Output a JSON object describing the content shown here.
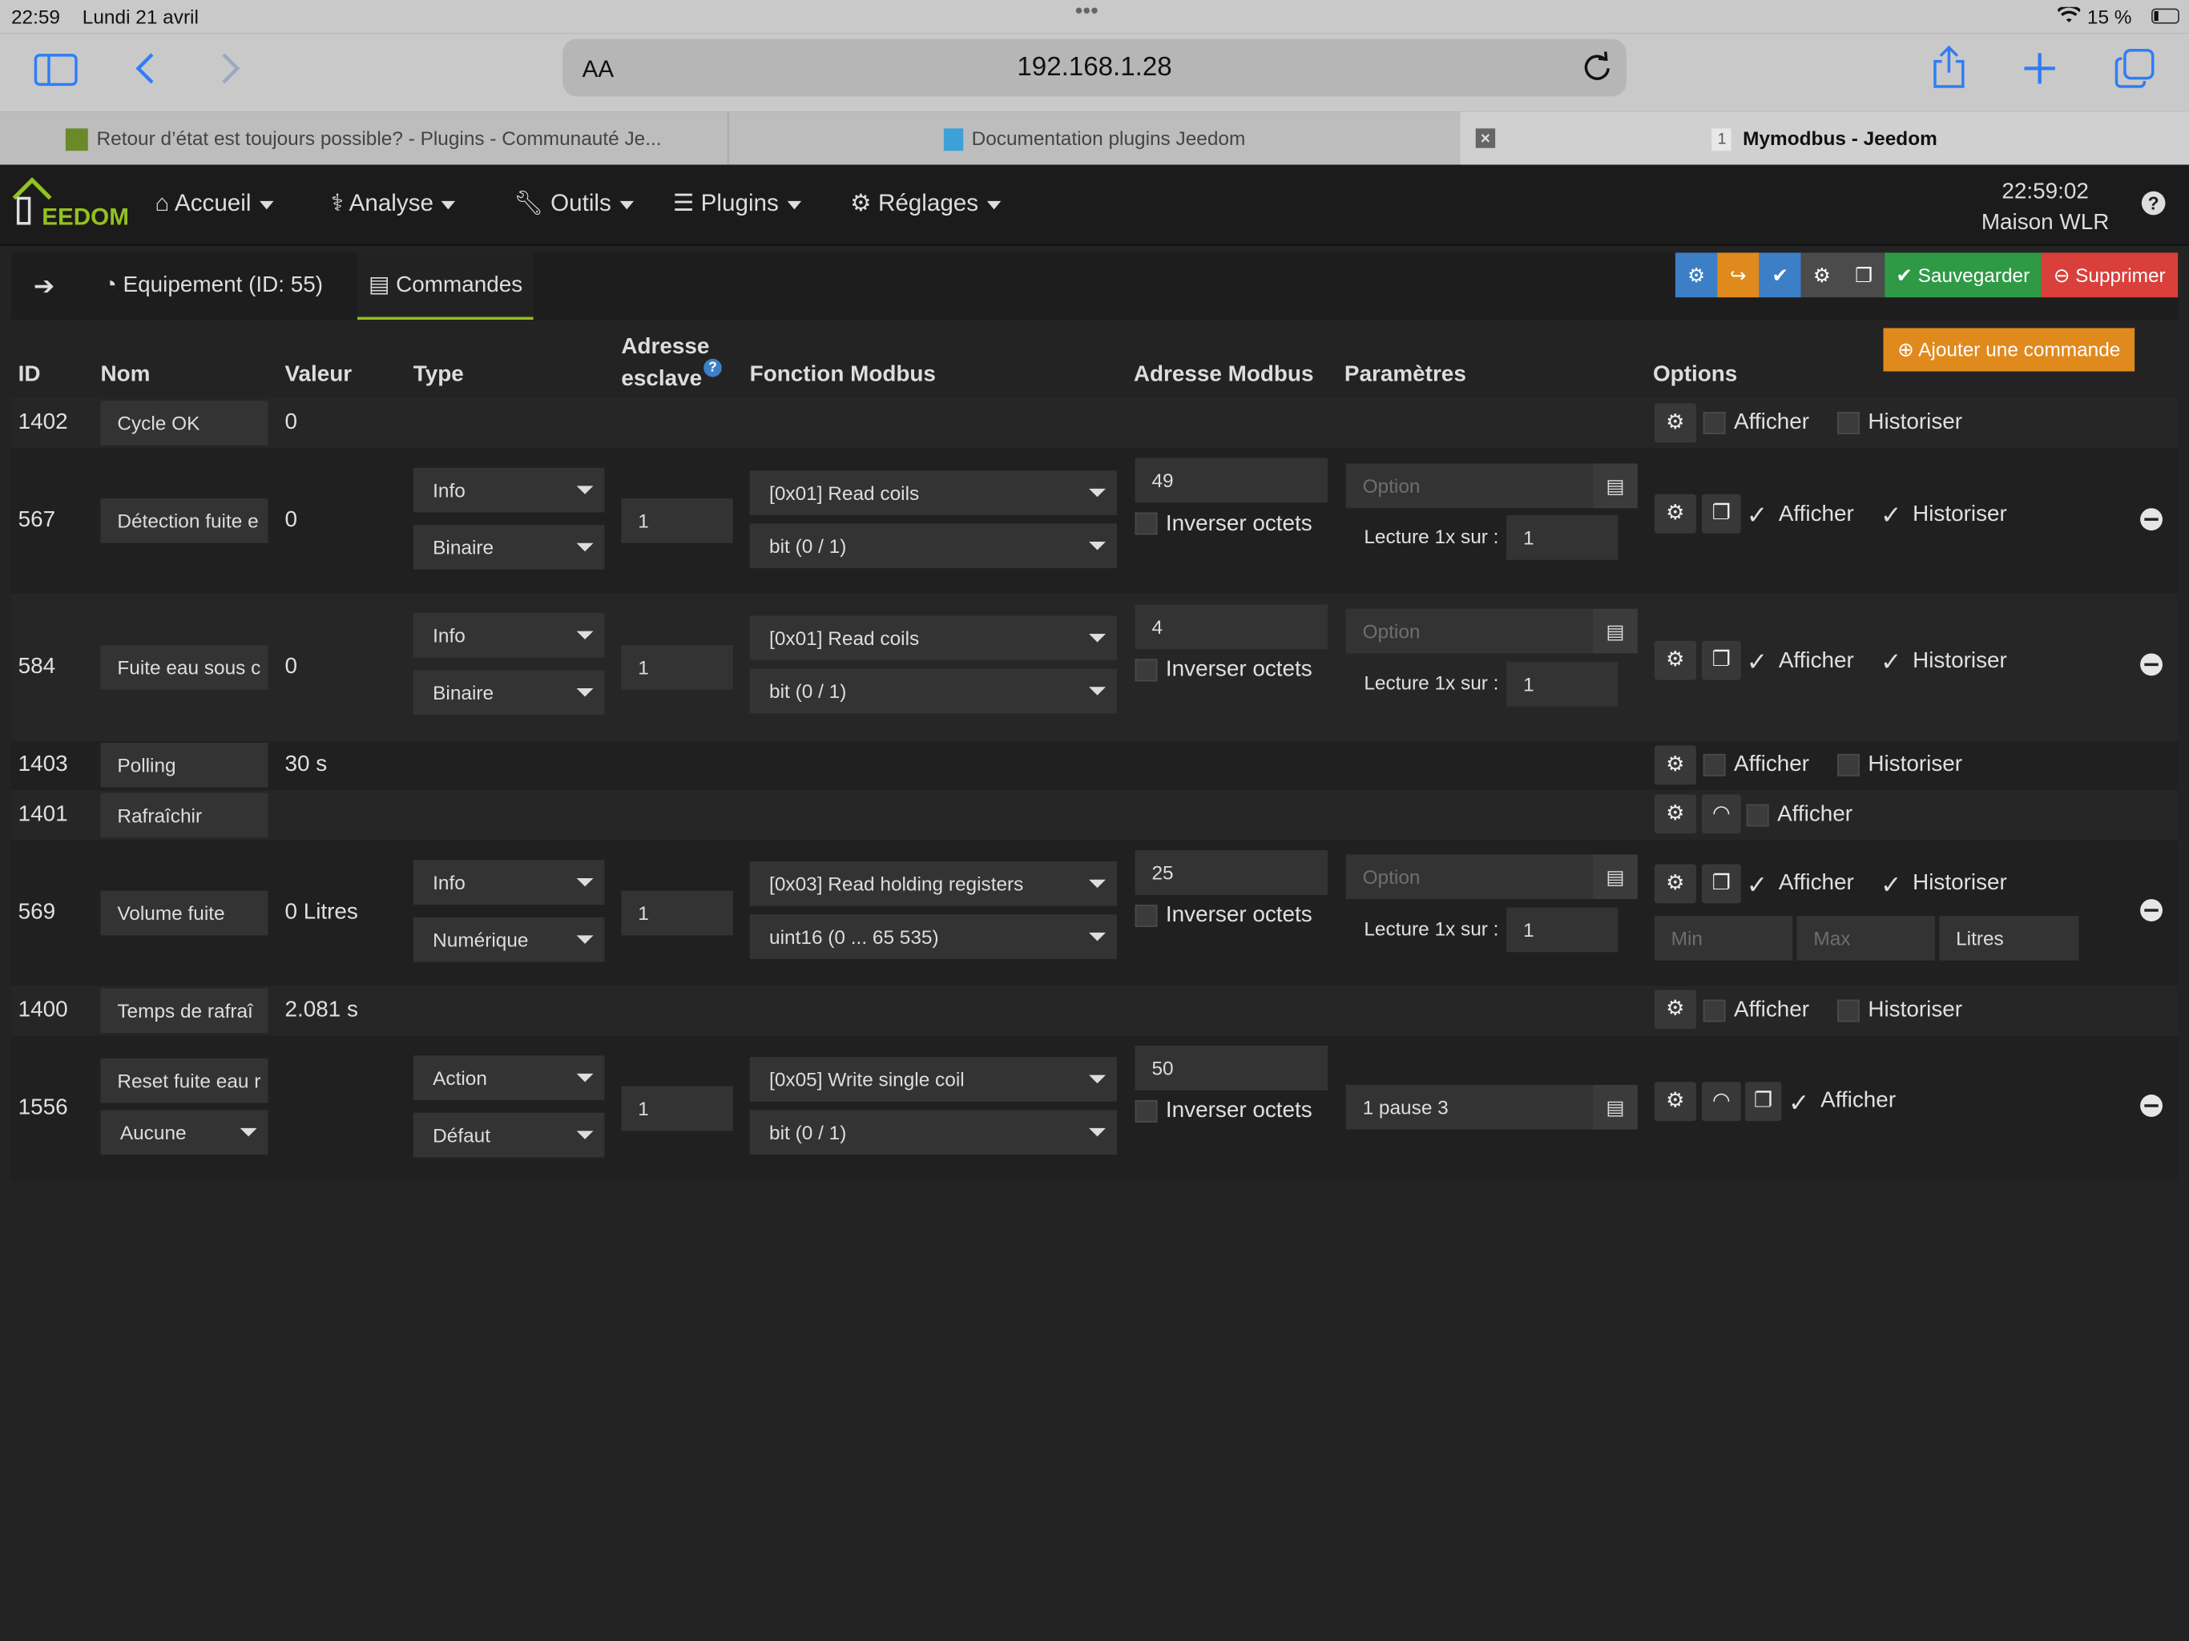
{
  "status": {
    "time": "22:59",
    "date": "Lundi 21 avril",
    "battery": "15 %",
    "dots": "•••"
  },
  "browser": {
    "text_size": "AA",
    "url": "192.168.1.28",
    "tabs": [
      {
        "label": "Retour d’état est toujours possible? - Plugins - Communauté Je..."
      },
      {
        "label": "Documentation plugins Jeedom"
      },
      {
        "label": "Mymodbus - Jeedom",
        "badge": "1"
      }
    ]
  },
  "nav": {
    "logo": "EEDOM",
    "items": [
      {
        "label": "Accueil",
        "icon": "home-icon"
      },
      {
        "label": "Analyse",
        "icon": "stethoscope-icon"
      },
      {
        "label": "Outils",
        "icon": "wrench-icon"
      },
      {
        "label": "Plugins",
        "icon": "list-icon"
      },
      {
        "label": "Réglages",
        "icon": "gear-icon"
      }
    ],
    "clock": "22:59:02",
    "house": "Maison WLR",
    "help": "?"
  },
  "page": {
    "tabs": {
      "equipment": "Equipement (ID: 55)",
      "commands": "Commandes"
    },
    "save_label": "Sauvegarder",
    "delete_label": "Supprimer",
    "add_command_label": "Ajouter une commande",
    "colors": {
      "blue": "#3c7fc6",
      "orange": "#e08a1e",
      "green": "#2e9a46",
      "red": "#d9403b"
    }
  },
  "table": {
    "headers": {
      "id": "ID",
      "nom": "Nom",
      "valeur": "Valeur",
      "type": "Type",
      "adresse_esclave": "Adresse esclave",
      "fonction": "Fonction Modbus",
      "adresse_modbus": "Adresse Modbus",
      "parametres": "Paramètres",
      "options": "Options"
    },
    "labels": {
      "afficher": "Afficher",
      "historiser": "Historiser",
      "inverser": "Inverser octets",
      "lecture": "Lecture 1x sur :",
      "option_ph": "Option",
      "min_ph": "Min",
      "max_ph": "Max"
    },
    "rows": [
      {
        "id": "1402",
        "nom": "Cycle OK",
        "valeur": "0"
      },
      {
        "id": "567",
        "nom": "Détection fuite e",
        "valeur": "0",
        "type": "Info",
        "subtype": "Binaire",
        "esclave": "1",
        "fonction": "[0x01] Read coils",
        "format": "bit (0 / 1)",
        "adresse": "49",
        "lecture": "1"
      },
      {
        "id": "584",
        "nom": "Fuite eau sous c",
        "valeur": "0",
        "type": "Info",
        "subtype": "Binaire",
        "esclave": "1",
        "fonction": "[0x01] Read coils",
        "format": "bit (0 / 1)",
        "adresse": "4",
        "lecture": "1"
      },
      {
        "id": "1403",
        "nom": "Polling",
        "valeur": "30 s"
      },
      {
        "id": "1401",
        "nom": "Rafraîchir",
        "valeur": ""
      },
      {
        "id": "569",
        "nom": "Volume fuite",
        "valeur": "0 Litres",
        "type": "Info",
        "subtype": "Numérique",
        "esclave": "1",
        "fonction": "[0x03] Read holding registers",
        "format": "uint16 (0 ... 65 535)",
        "adresse": "25",
        "lecture": "1",
        "unit": "Litres"
      },
      {
        "id": "1400",
        "nom": "Temps de rafraî",
        "valeur": "2.081 s"
      },
      {
        "id": "1556",
        "nom": "Reset fuite eau r",
        "nom_select": "Aucune",
        "type": "Action",
        "subtype": "Défaut",
        "esclave": "1",
        "fonction": "[0x05] Write single coil",
        "format": "bit (0 / 1)",
        "adresse": "50",
        "param": "1 pause 3"
      }
    ]
  }
}
